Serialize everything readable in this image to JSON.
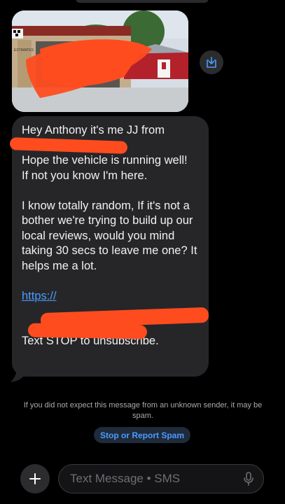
{
  "colors": {
    "background": "#000000",
    "bubble": "#262629",
    "accent": "#4a9cff",
    "redaction": "#ff4c1f"
  },
  "image_message": {
    "sign_text": "ESTIMATES",
    "save_icon": "save-to-photos-icon"
  },
  "message": {
    "line1": "Hey Anthony it's me JJ from",
    "para2": "Hope the vehicle is running well!\nIf not you know I'm here.",
    "para3": "I know totally random, If it's not a bother we're trying to build up our local reviews, would you mind taking 30 secs to leave me one? It helps me a lot.",
    "link_partial": "https://",
    "stop": "Text STOP to unsubscribe."
  },
  "warning": "If you did not expect this message from an unknown sender, it may be spam.",
  "spam_button": "Stop or Report Spam",
  "composer": {
    "placeholder": "Text Message • SMS",
    "plus_icon": "plus-icon",
    "mic_icon": "microphone-icon"
  }
}
